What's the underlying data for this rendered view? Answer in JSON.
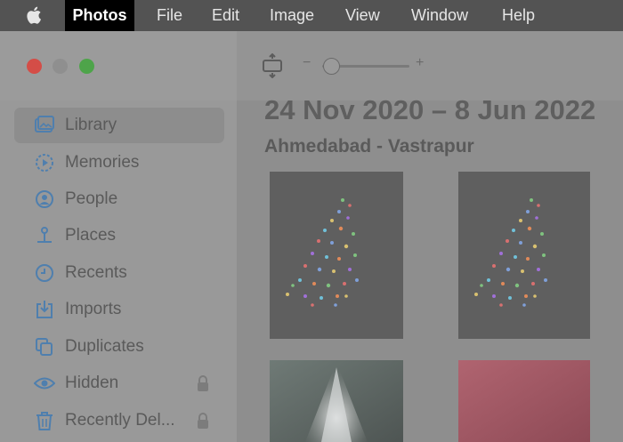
{
  "menubar": {
    "app": "Photos",
    "items": [
      "File",
      "Edit",
      "Image",
      "View",
      "Window",
      "Help"
    ]
  },
  "sidebar": {
    "items": [
      {
        "label": "Library",
        "icon": "library-icon",
        "selected": true
      },
      {
        "label": "Memories",
        "icon": "memories-icon"
      },
      {
        "label": "People",
        "icon": "people-icon"
      },
      {
        "label": "Places",
        "icon": "places-icon"
      },
      {
        "label": "Recents",
        "icon": "recents-icon"
      },
      {
        "label": "Imports",
        "icon": "imports-icon"
      },
      {
        "label": "Duplicates",
        "icon": "duplicates-icon"
      },
      {
        "label": "Hidden",
        "icon": "hidden-icon",
        "locked": true
      },
      {
        "label": "Recently Del...",
        "icon": "trash-icon",
        "locked": true
      }
    ]
  },
  "toolbar": {
    "zoom_minus": "−",
    "zoom_plus": "+"
  },
  "main": {
    "date_range": "24 Nov 2020 – 8 Jun 2022",
    "location": "Ahmedabad - Vastrapur"
  },
  "colors": {
    "menubar_bg": "#535353",
    "active_menu_bg": "#000000",
    "close": "#d44d47",
    "minimize": "#8f8f8f",
    "zoom": "#4ea44a",
    "accent_icon": "#4f7fae"
  }
}
